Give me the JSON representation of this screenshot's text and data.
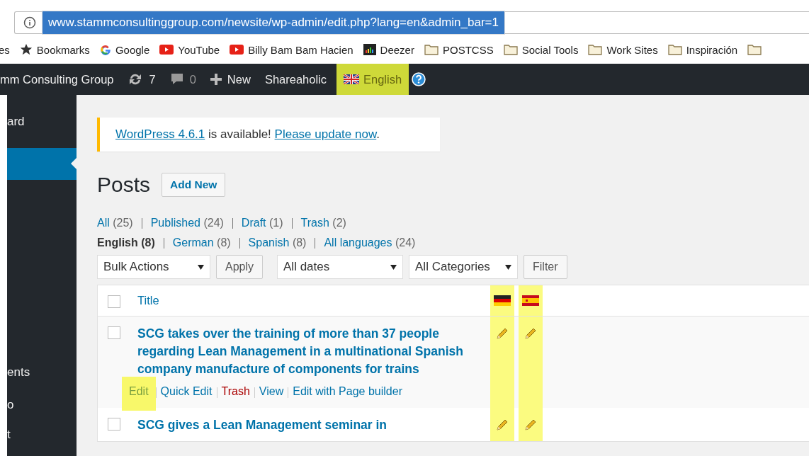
{
  "browser": {
    "url": "www.stammconsultinggroup.com/newsite/wp-admin/edit.php?lang=en&admin_bar=1",
    "url_selected": true,
    "bookmarks": [
      {
        "kind": "text",
        "label": "es"
      },
      {
        "kind": "star",
        "label": "Bookmarks"
      },
      {
        "kind": "google",
        "label": "Google"
      },
      {
        "kind": "youtube",
        "label": "YouTube"
      },
      {
        "kind": "youtube",
        "label": "Billy Bam Bam Hacien"
      },
      {
        "kind": "deezer",
        "label": "Deezer"
      },
      {
        "kind": "folder",
        "label": "POSTCSS"
      },
      {
        "kind": "folder",
        "label": "Social Tools"
      },
      {
        "kind": "folder",
        "label": "Work Sites"
      },
      {
        "kind": "folder",
        "label": "Inspiración"
      },
      {
        "kind": "folder"
      }
    ]
  },
  "admin_bar": {
    "site": "mm Consulting Group",
    "updates": "7",
    "comments": "0",
    "new": "New",
    "plugin": "Shareaholic",
    "language": {
      "label": "English",
      "highlighted": true
    }
  },
  "sidebar": {
    "items": [
      {
        "label": "ard",
        "selected": false
      },
      {
        "selected": true
      },
      {
        "label": "ents",
        "selected": false
      },
      {
        "label": "o",
        "selected": false
      },
      {
        "label": "t",
        "selected": false
      }
    ]
  },
  "notice": {
    "segments": [
      {
        "kind": "link",
        "text": "WordPress 4.6.1"
      },
      {
        "kind": "text",
        "text": " is available! "
      },
      {
        "kind": "link",
        "text": "Please update now"
      },
      {
        "kind": "text",
        "text": "."
      }
    ]
  },
  "page_title": "Posts",
  "add_new": "Add New",
  "status_filters": [
    {
      "label": "All",
      "count": "(25)",
      "selected": false
    },
    {
      "label": "Published",
      "count": "(24)",
      "selected": false
    },
    {
      "label": "Draft",
      "count": "(1)",
      "selected": false
    },
    {
      "label": "Trash",
      "count": "(2)",
      "selected": false
    }
  ],
  "language_filters": [
    {
      "label": "English",
      "count": "(8)",
      "selected": true
    },
    {
      "label": "German",
      "count": "(8)",
      "selected": false
    },
    {
      "label": "Spanish",
      "count": "(8)",
      "selected": false
    },
    {
      "label": "All languages",
      "count": "(24)",
      "selected": false
    }
  ],
  "toolbar": [
    {
      "kind": "select",
      "label": "Bulk Actions"
    },
    {
      "kind": "button",
      "label": "Apply"
    },
    {
      "kind": "select",
      "label": "All dates"
    },
    {
      "kind": "select",
      "label": "All Categories"
    },
    {
      "kind": "button",
      "label": "Filter"
    }
  ],
  "table": {
    "select_all_checked": false,
    "title_column": "Title",
    "language_columns": [
      {
        "kind": "de",
        "highlighted": true
      },
      {
        "kind": "es",
        "highlighted": true
      }
    ],
    "rows": [
      {
        "title": "SCG takes over the training of more than 37 people regarding Lean Management in a multinational Spanish company manufacture of components for trains",
        "checked": false,
        "actions": [
          {
            "label": "Edit",
            "kind": "normal",
            "highlighted": true
          },
          {
            "label": "Quick Edit",
            "kind": "normal",
            "highlighted": false
          },
          {
            "label": "Trash",
            "kind": "danger",
            "highlighted": false
          },
          {
            "label": "View",
            "kind": "normal",
            "highlighted": false
          },
          {
            "label": "Edit with Page builder",
            "kind": "normal",
            "highlighted": false
          }
        ]
      },
      {
        "title": "SCG gives a Lean Management seminar in",
        "checked": false,
        "actions": []
      }
    ]
  }
}
